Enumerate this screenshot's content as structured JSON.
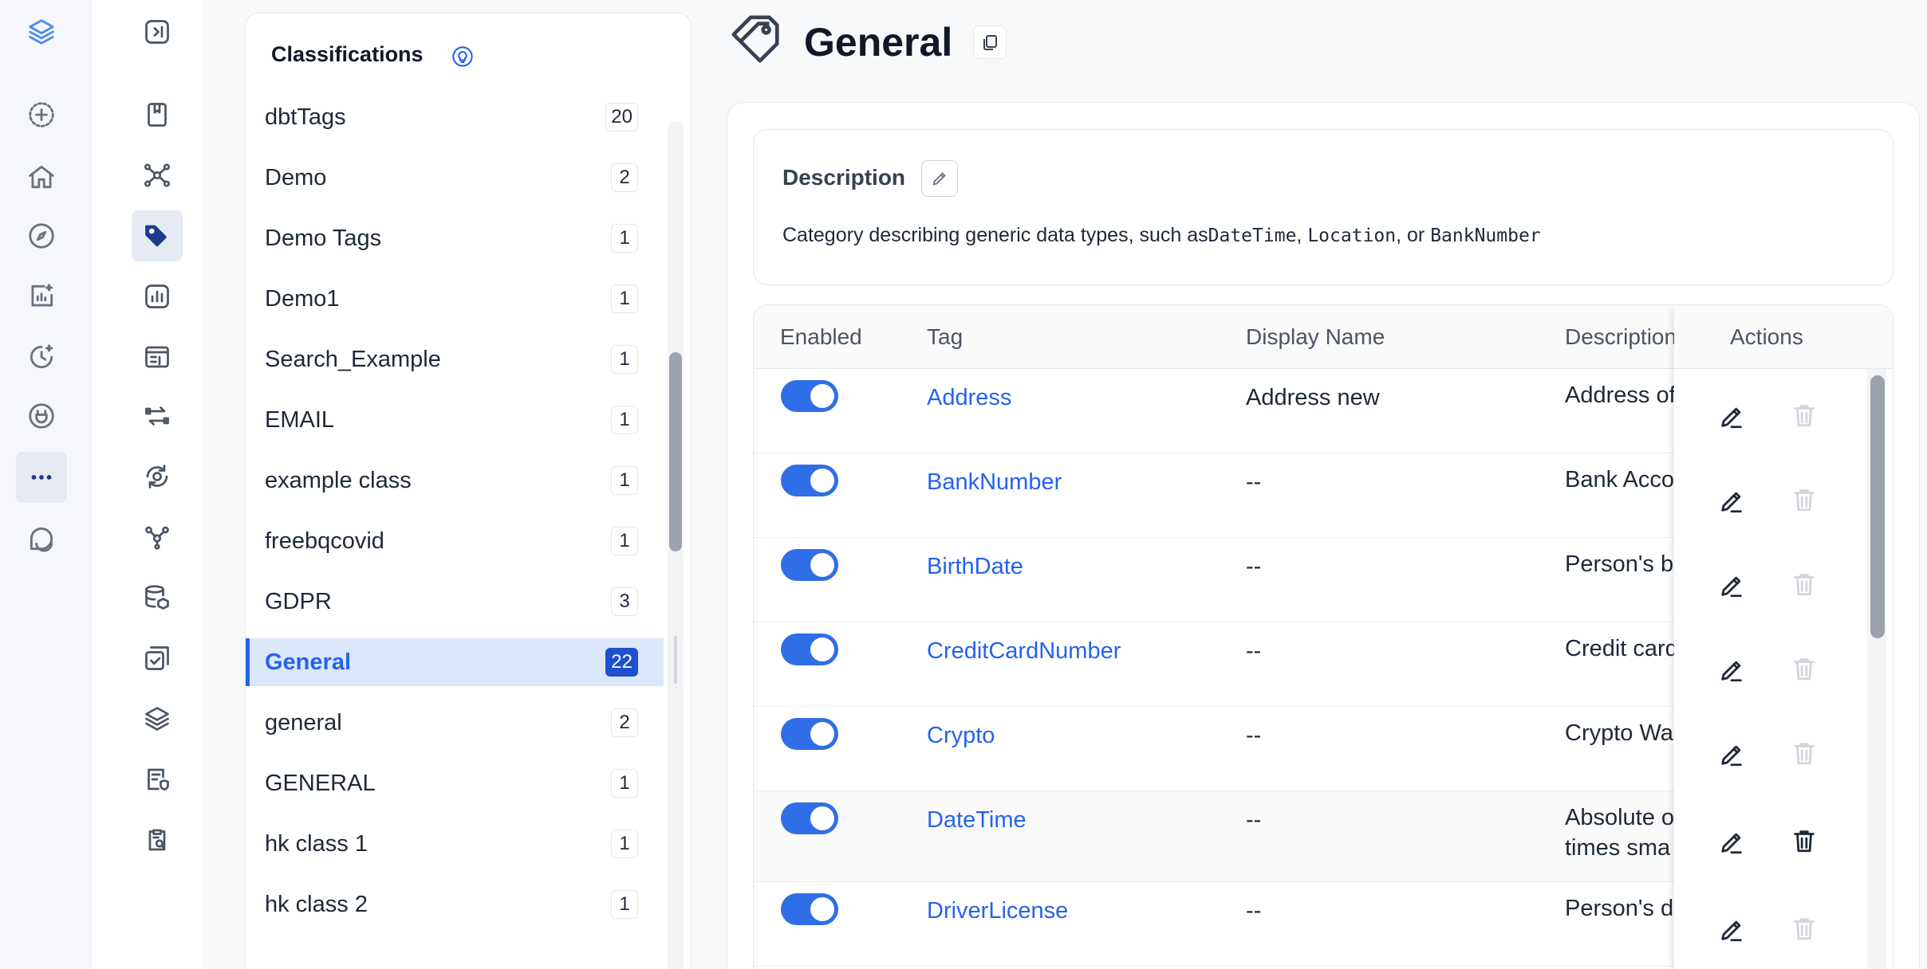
{
  "rail": {
    "items": [
      {
        "icon": "logo-layers-icon"
      },
      {
        "icon": "plus-icon"
      },
      {
        "icon": "home-icon"
      },
      {
        "icon": "compass-icon"
      },
      {
        "icon": "insights-chart-icon"
      },
      {
        "icon": "clock-sparkle-icon"
      },
      {
        "icon": "plug-icon"
      },
      {
        "icon": "more-dots-icon",
        "active": true
      },
      {
        "icon": "chat-icon"
      }
    ]
  },
  "subnav": {
    "items": [
      {
        "icon": "sidebar-toggle-icon"
      },
      {
        "icon": "glossary-book-icon"
      },
      {
        "icon": "lineage-network-icon"
      },
      {
        "icon": "tags-icon",
        "active": true
      },
      {
        "icon": "bar-chart-icon"
      },
      {
        "icon": "table-layout-icon"
      },
      {
        "icon": "transfer-icon"
      },
      {
        "icon": "settings-sync-icon"
      },
      {
        "icon": "nodes-icon"
      },
      {
        "icon": "database-icon"
      },
      {
        "icon": "task-check-icon"
      },
      {
        "icon": "stack-layers-icon"
      },
      {
        "icon": "policy-check-icon"
      },
      {
        "icon": "clipboard-search-icon"
      }
    ]
  },
  "classifications": {
    "title": "Classifications",
    "items": [
      {
        "name": "dbtTags",
        "count": "20"
      },
      {
        "name": "Demo",
        "count": "2"
      },
      {
        "name": "Demo Tags",
        "count": "1"
      },
      {
        "name": "Demo1",
        "count": "1"
      },
      {
        "name": "Search_Example",
        "count": "1"
      },
      {
        "name": "EMAIL",
        "count": "1"
      },
      {
        "name": "example class",
        "count": "1"
      },
      {
        "name": "freebqcovid",
        "count": "1"
      },
      {
        "name": "GDPR",
        "count": "3"
      },
      {
        "name": "General",
        "count": "22",
        "active": true
      },
      {
        "name": "general",
        "count": "2"
      },
      {
        "name": "GENERAL",
        "count": "1"
      },
      {
        "name": "hk class 1",
        "count": "1"
      },
      {
        "name": "hk class 2",
        "count": "1"
      }
    ]
  },
  "header": {
    "title": "General"
  },
  "description": {
    "label": "Description",
    "text_prefix": "Category describing generic data types, such as",
    "code1": "DateTime",
    "sep1": ", ",
    "code2": "Location",
    "sep2": ", or ",
    "code3": "BankNumber"
  },
  "table": {
    "headers": {
      "enabled": "Enabled",
      "tag": "Tag",
      "display_name": "Display Name",
      "description": "Description",
      "actions": "Actions"
    },
    "rows": [
      {
        "tag": "Address",
        "display": "Address new",
        "desc": "Address of",
        "desc2": ""
      },
      {
        "tag": "BankNumber",
        "display": "--",
        "desc": "Bank Acco",
        "desc2": ""
      },
      {
        "tag": "BirthDate",
        "display": "--",
        "desc": "Person's b",
        "desc2": ""
      },
      {
        "tag": "CreditCardNumber",
        "display": "--",
        "desc": "Credit card",
        "desc2": ""
      },
      {
        "tag": "Crypto",
        "display": "--",
        "desc": "Crypto Wa",
        "desc2": ""
      },
      {
        "tag": "DateTime",
        "display": "--",
        "desc": "Absolute o",
        "desc2": "times sma"
      },
      {
        "tag": "DriverLicense",
        "display": "--",
        "desc": "Person's d",
        "desc2": ""
      }
    ]
  }
}
